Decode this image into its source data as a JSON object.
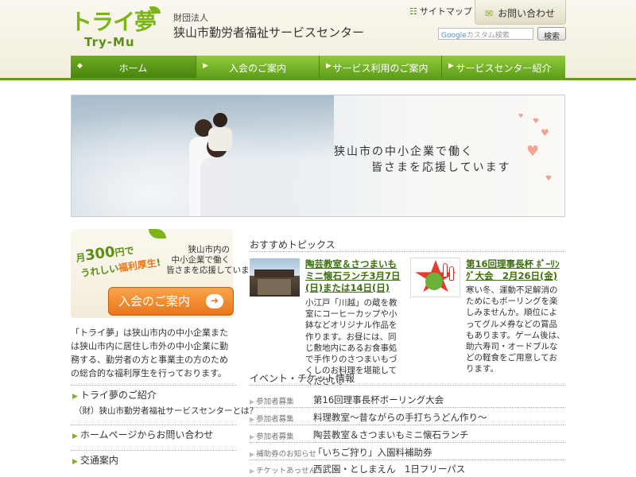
{
  "header": {
    "logo_text": "トライ夢",
    "logo_sub": "Try-Mu",
    "org_type": "財団法人",
    "org_name": "狭山市勤労者福祉サービスセンター",
    "sitemap_label": "サイトマップ",
    "contact_label": "お問い合わせ",
    "search_brand": "Google",
    "search_placeholder": "カスタム検索",
    "search_button": "検索"
  },
  "nav": {
    "items": [
      {
        "label": "ホーム",
        "active": true
      },
      {
        "label": "入会のご案内"
      },
      {
        "label": "サービス利用のご案内"
      },
      {
        "label": "サービスセンター紹介"
      }
    ]
  },
  "banner": {
    "line1": "狭山市の中小企業で働く",
    "line2": "皆さまを応援しています"
  },
  "promo": {
    "badge_prefix": "月",
    "badge_amount": "300",
    "badge_unit": "円で",
    "badge_line2_a": "うれしい",
    "badge_line2_b": "福利厚生",
    "badge_line2_c": "!",
    "text1": "狭山市内の",
    "text2": "中小企業で働く",
    "text3": "皆さまを応援しています",
    "join_button": "入会のご案内"
  },
  "intro": "「トライ夢」は狭山市内の中小企業または狭山市内に居住し市外の中小企業に勤務する、勤労者の方と事業主の方のための総合的な福利厚生を行っております。",
  "side_links": [
    {
      "title": "トライ夢のご紹介",
      "sub": "（財）狭山市勤労者福祉サービスセンターとは？"
    },
    {
      "title": "ホームページからお問い合わせ",
      "sub": ""
    },
    {
      "title": "交通案内",
      "sub": ""
    }
  ],
  "topics": {
    "heading": "おすすめトピックス",
    "items": [
      {
        "title": "陶芸教室＆さつまいもミニ懐石ランチ3月7日(日)または14日(日)",
        "body": "小江戸「川越」の蔵を教室にコーヒーカップや小鉢などオリジナル作品を作ります。お昼には、同じ敷地内にあるお食事処で手作りのさつまいもづくしのお料理を堪能してください。"
      },
      {
        "title": "第16回理事長杯 ﾎﾞｰﾘﾝｸﾞ大会　2月26日(金)",
        "body": "寒い冬、運動不足解消のためにもボーリングを楽しみませんか。順位によってグルメ券などの賞品もあります。ゲーム後は、助六寿司・オードブルなどの軽食をご用意しております。"
      }
    ]
  },
  "events": {
    "heading": "イベント・チケット情報",
    "rows": [
      {
        "category": "参加者募集",
        "name": "第16回理事長杯ボーリング大会"
      },
      {
        "category": "参加者募集",
        "name": "料理教室～昔ながらの手打ちうどん作り～"
      },
      {
        "category": "参加者募集",
        "name": "陶芸教室＆さつまいもミニ懐石ランチ"
      },
      {
        "category": "補助券のお知らせ",
        "name": "「いちご狩り」入園料補助券"
      },
      {
        "category": "チケットあっせん",
        "name": "西武園・としまえん　1日フリーパス"
      }
    ]
  }
}
